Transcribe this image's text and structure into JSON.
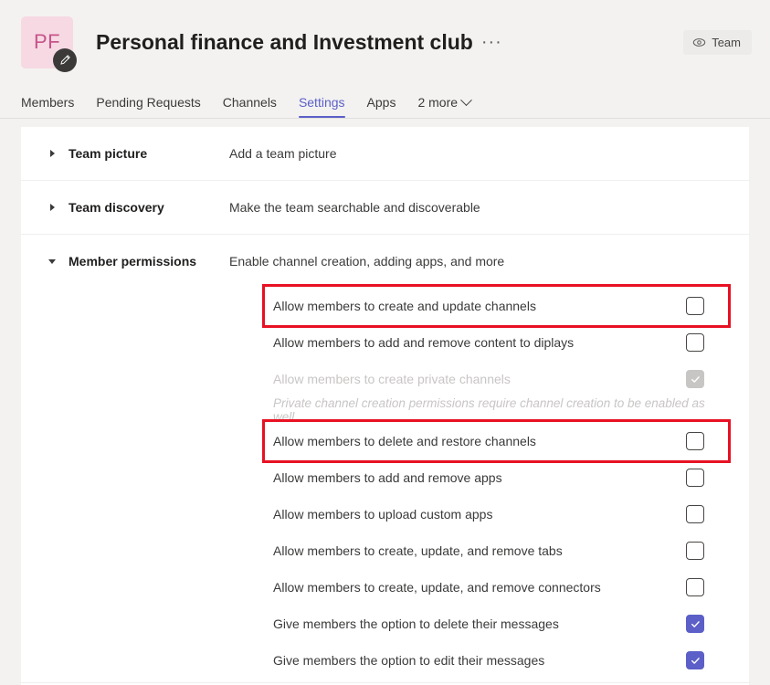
{
  "header": {
    "avatar_initials": "PF",
    "avatar_bg": "#F6D9E3",
    "avatar_text_color": "#C8538A",
    "edit_badge_icon": "pencil-icon",
    "title": "Personal finance and Investment club",
    "more_options": "···",
    "team_button": {
      "label": "Team",
      "icon": "eye-icon"
    }
  },
  "tabs": {
    "active_accent": "#5B5FC7",
    "items": [
      {
        "label": "Members",
        "active": false
      },
      {
        "label": "Pending Requests",
        "active": false
      },
      {
        "label": "Channels",
        "active": false
      },
      {
        "label": "Settings",
        "active": true
      },
      {
        "label": "Apps",
        "active": false
      },
      {
        "label": "2 more",
        "active": false,
        "icon": "chevron-down-icon"
      }
    ]
  },
  "sections": [
    {
      "title": "Team picture",
      "description": "Add a team picture",
      "expanded": false
    },
    {
      "title": "Team discovery",
      "description": "Make the team searchable and discoverable",
      "expanded": false
    },
    {
      "title": "Member permissions",
      "description": "Enable channel creation, adding apps, and more",
      "expanded": true
    }
  ],
  "permissions": [
    {
      "label": "Allow members to create and update channels",
      "checked": false,
      "disabled": false,
      "highlighted": true
    },
    {
      "label": "Allow members to add and remove content to diplays",
      "checked": false,
      "disabled": false,
      "highlighted": false
    },
    {
      "label": "Allow members to create private channels",
      "checked": true,
      "disabled": true,
      "highlighted": false,
      "note": "Private channel creation permissions require channel creation to be enabled as well."
    },
    {
      "label": "Allow members to delete and restore channels",
      "checked": false,
      "disabled": false,
      "highlighted": true
    },
    {
      "label": "Allow members to add and remove apps",
      "checked": false,
      "disabled": false,
      "highlighted": false
    },
    {
      "label": "Allow members to upload custom apps",
      "checked": false,
      "disabled": false,
      "highlighted": false
    },
    {
      "label": "Allow members to create, update, and remove tabs",
      "checked": false,
      "disabled": false,
      "highlighted": false
    },
    {
      "label": "Allow members to create, update, and remove connectors",
      "checked": false,
      "disabled": false,
      "highlighted": false
    },
    {
      "label": "Give members the option to delete their messages",
      "checked": true,
      "disabled": false,
      "highlighted": false
    },
    {
      "label": "Give members the option to edit their messages",
      "checked": true,
      "disabled": false,
      "highlighted": false
    }
  ],
  "colors": {
    "accent": "#5B5FC7",
    "annotation": "#E81123",
    "page_bg": "#F3F2F1",
    "panel_bg": "#FFFFFF"
  }
}
